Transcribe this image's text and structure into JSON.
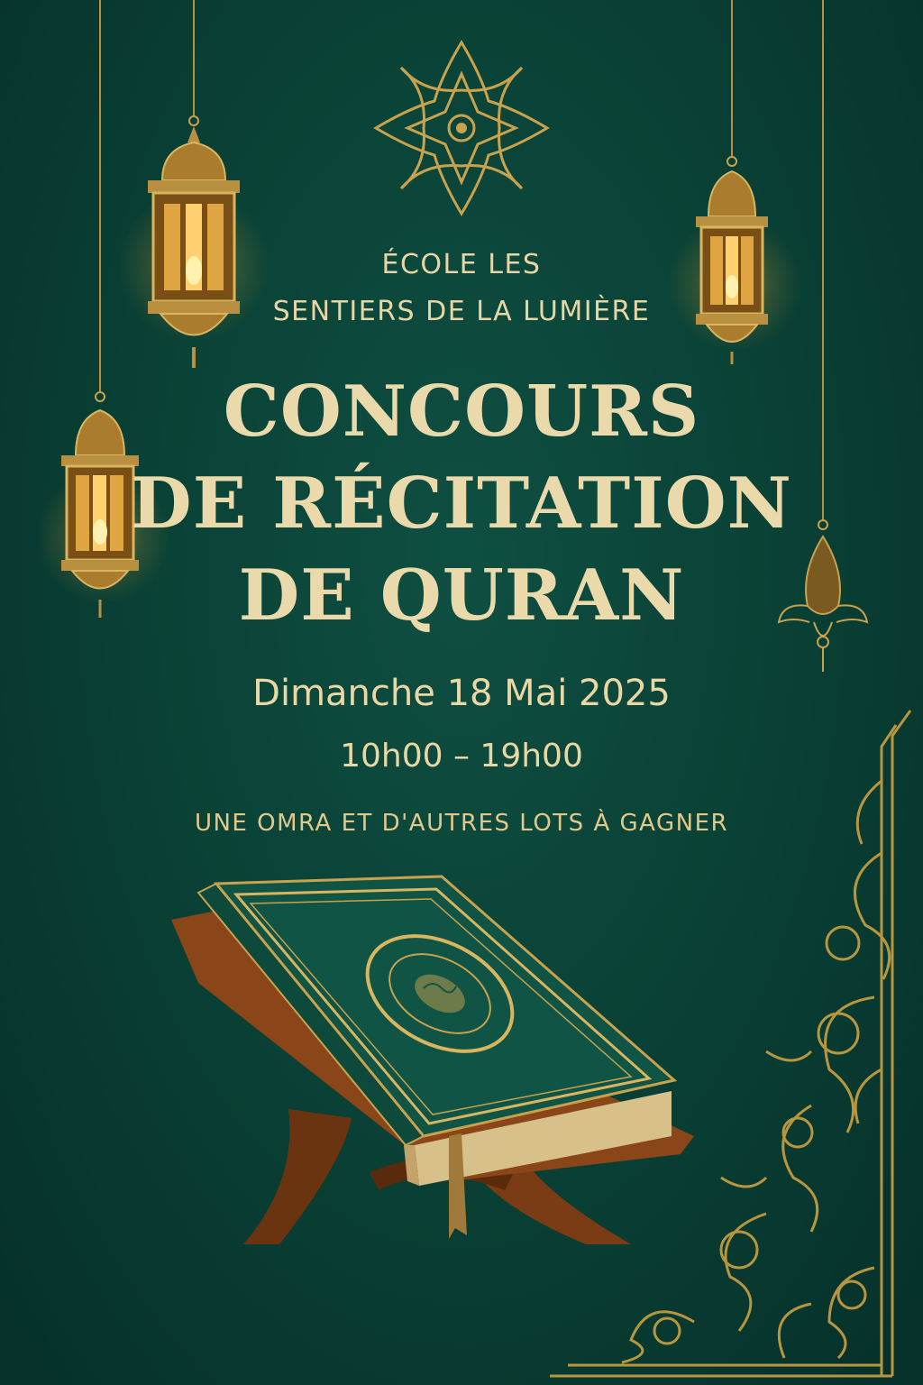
{
  "poster": {
    "school_line1": "ÉCOLE LES",
    "school_line2": "SENTIERS DE LA LUMIÈRE",
    "title_line1": "CONCOURS",
    "title_line2": "DE RÉCITATION",
    "title_line3": "DE QURAN",
    "date": "Dimanche 18 Mai 2025",
    "hours": "10h00 – 19h00",
    "prize": "UNE OMRA ET D'AUTRES LOTS À GAGNER"
  },
  "colors": {
    "background": "#0a4236",
    "gold": "#c9a24e",
    "text": "#e8d6a6"
  },
  "decorations": [
    "star-ornament-icon",
    "hanging-lantern",
    "quran-book",
    "wooden-rehal-stand",
    "arabesque-corner-ornament"
  ]
}
